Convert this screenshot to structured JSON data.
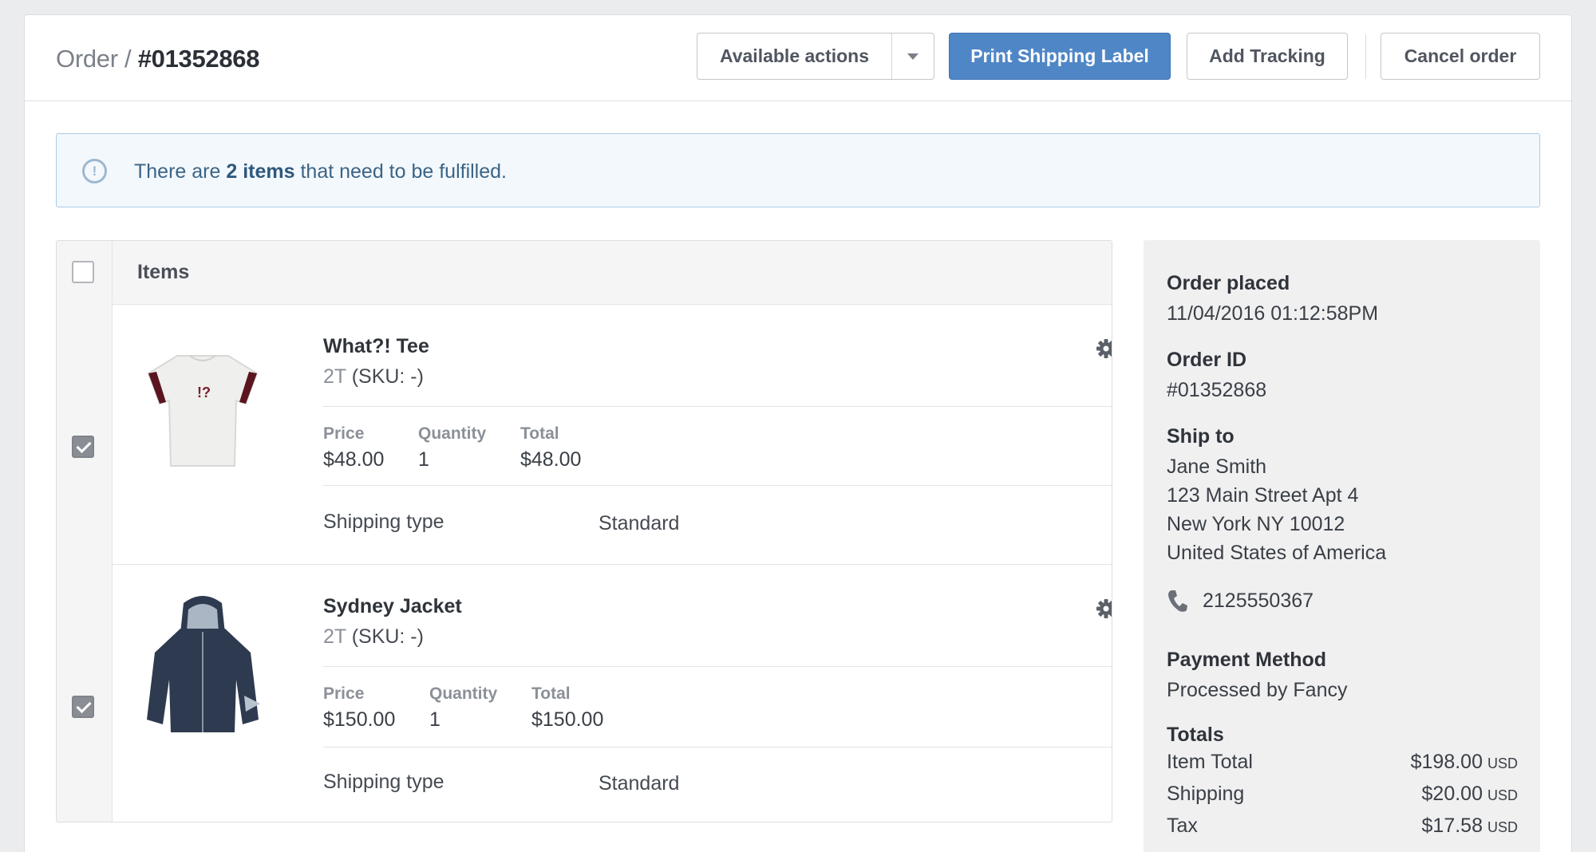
{
  "header": {
    "crumb_prefix": "Order /",
    "order_number": "#01352868",
    "available_actions": "Available actions",
    "print_label": "Print Shipping Label",
    "add_tracking": "Add Tracking",
    "cancel_order": "Cancel order"
  },
  "alert": {
    "pre": "There are",
    "count": "2 items",
    "post": "that need to be fulfilled."
  },
  "items": {
    "title": "Items",
    "header_checked": false,
    "rows": [
      {
        "name": "What?! Tee",
        "variant": "2T",
        "sku": "(SKU: -)",
        "checked": true,
        "price_label": "Price",
        "price": "$48.00",
        "qty_label": "Quantity",
        "qty": "1",
        "total_label": "Total",
        "total": "$48.00",
        "shipping_label": "Shipping type",
        "shipping": "Standard",
        "print": "!?"
      },
      {
        "name": "Sydney Jacket",
        "variant": "2T",
        "sku": "(SKU: -)",
        "checked": true,
        "price_label": "Price",
        "price": "$150.00",
        "qty_label": "Quantity",
        "qty": "1",
        "total_label": "Total",
        "total": "$150.00",
        "shipping_label": "Shipping type",
        "shipping": "Standard"
      }
    ]
  },
  "sidebar": {
    "order_placed_label": "Order placed",
    "order_placed": "11/04/2016 01:12:58PM",
    "order_id_label": "Order ID",
    "order_id": "#01352868",
    "ship_to_label": "Ship to",
    "ship_name": "Jane Smith",
    "ship_line1": "123 Main Street Apt 4",
    "ship_line2": "New York NY 10012",
    "ship_country": "United States of America",
    "phone": "2125550367",
    "payment_label": "Payment Method",
    "payment": "Processed by Fancy",
    "totals_label": "Totals",
    "totals": [
      {
        "label": "Item Total",
        "amount": "$198.00",
        "currency": "USD"
      },
      {
        "label": "Shipping",
        "amount": "$20.00",
        "currency": "USD"
      },
      {
        "label": "Tax",
        "amount": "$17.58",
        "currency": "USD"
      }
    ]
  },
  "icons": {
    "alert": "info-circle-icon",
    "gear": "gear-icon",
    "phone": "phone-icon"
  },
  "colors": {
    "primary": "#4f86c6",
    "alert_bg": "#f3f8fc",
    "alert_border": "#a9cbe4",
    "sidebar_bg": "#f0f0f1"
  }
}
